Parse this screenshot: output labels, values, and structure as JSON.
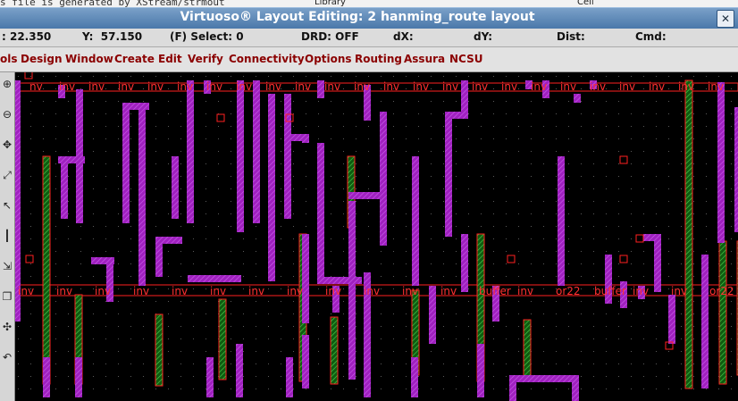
{
  "behind": {
    "text": "s file is generated by XStream/strmout",
    "library": "Library",
    "cell": "Cell"
  },
  "window": {
    "title": "Virtuoso® Layout Editing: 2 hanming_route layout",
    "close_glyph": "✕"
  },
  "status": {
    "x": ": 22.350",
    "y": "Y:  57.150",
    "select": "(F) Select: 0",
    "drd": "DRD: OFF",
    "dx": "dX:",
    "dy": "dY:",
    "dist": "Dist:",
    "cmd": "Cmd:"
  },
  "menu": [
    "ols",
    "Design",
    "Window",
    "Create",
    "Edit",
    "Verify",
    "Connectivity",
    "Options",
    "Routing",
    "Assura",
    "NCSU"
  ],
  "tools": [
    "zoom-in-icon",
    "zoom-out-icon",
    "pan-icon",
    "fit-icon",
    "pointer-icon",
    "ruler-icon",
    "stretch-icon",
    "copy-icon",
    "move-icon",
    "undo-icon"
  ],
  "colors": {
    "metal1": "#a020c0",
    "metal2": "#1fa020",
    "boundary": "#ff2020",
    "grid": "#4a4a4a"
  },
  "row1_labels": [
    "nv",
    "inv",
    "inv",
    "inv",
    "inv",
    "inv",
    "inv",
    "inv",
    "inv",
    "inv",
    "inv",
    "inv",
    "inv",
    "inv",
    "inv",
    "inv",
    "inv",
    "inv",
    "inv",
    "inv",
    "inv",
    "inv",
    "inv",
    "inv"
  ],
  "row2_labels": [
    "inv",
    "inv",
    "inv",
    "inv",
    "inv",
    "inv",
    "inv",
    "inv",
    "inv",
    "inv",
    "inv",
    "inv",
    "buffer",
    "inv",
    "or22",
    "buffer",
    "inv",
    "inv",
    "or22"
  ]
}
